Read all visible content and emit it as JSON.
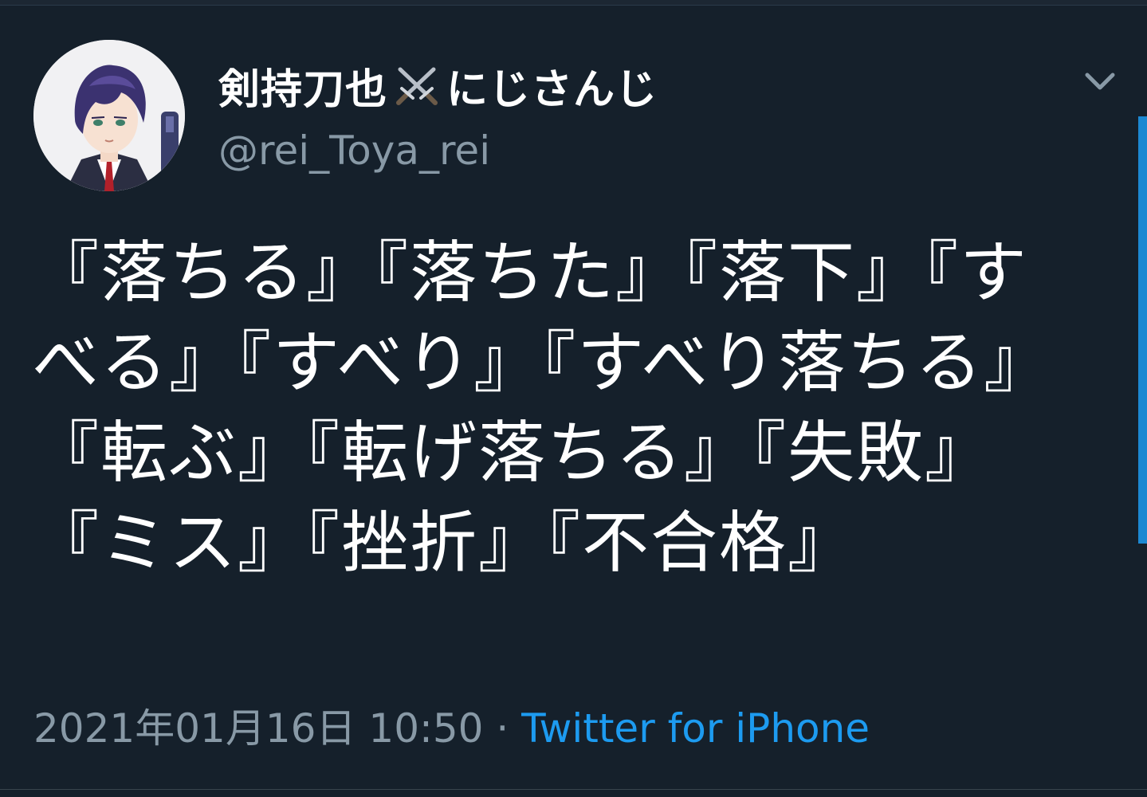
{
  "tweet": {
    "display_name_prefix": "剣持刀也",
    "display_name_emoji": "swords-icon",
    "display_name_suffix": "にじさんじ",
    "handle": "@rei_Toya_rei",
    "text": "『落ちる』『落ちた』『落下』『すべる』『すべり』『すべり落ちる』『転ぶ』『転げ落ちる』『失敗』『ミス』『挫折』『不合格』",
    "timestamp": "2021年01月16日 10:50",
    "separator": " · ",
    "source": "Twitter for iPhone",
    "menu_icon": "chevron-down-icon",
    "avatar_icon": "avatar-anime-character"
  },
  "colors": {
    "background": "#15202b",
    "text": "#ffffff",
    "secondary": "#8899a6",
    "link": "#1d9bf0"
  }
}
